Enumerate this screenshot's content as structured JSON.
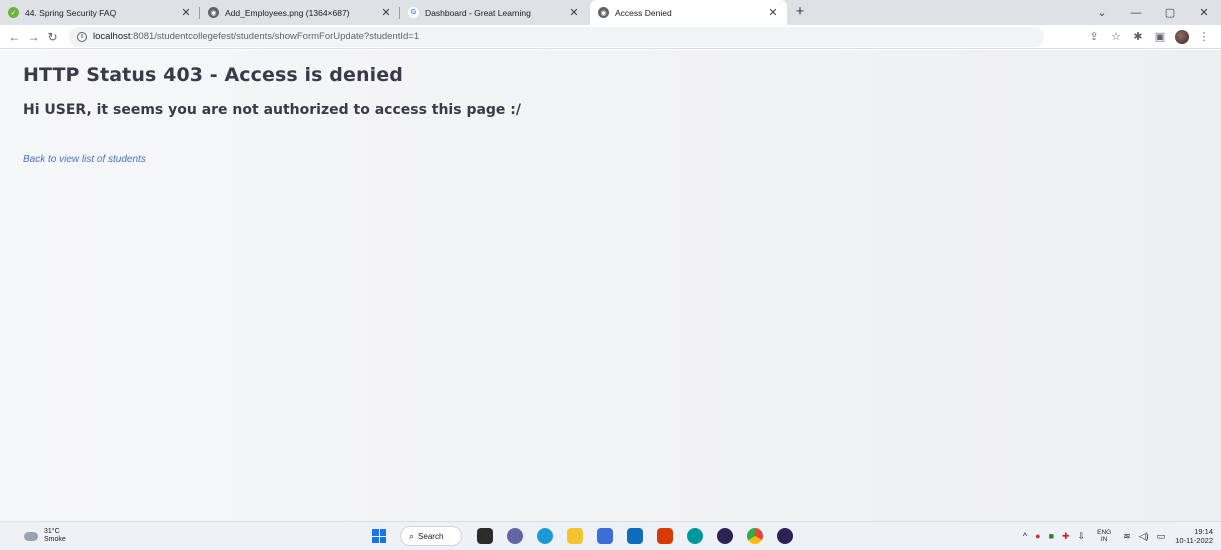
{
  "tabs": [
    {
      "title": "44. Spring Security FAQ",
      "icon": "spring-icon",
      "active": false
    },
    {
      "title": "Add_Employees.png (1364×687)",
      "icon": "globe-icon",
      "active": false
    },
    {
      "title": "Dashboard - Great Learning",
      "icon": "google-icon",
      "active": false
    },
    {
      "title": "Access Denied",
      "icon": "globe-icon",
      "active": true
    }
  ],
  "toolbar": {
    "url_host": "localhost",
    "url_path": ":8081/studentcollegefest/students/showFormForUpdate?studentId=1"
  },
  "page": {
    "heading": "HTTP Status 403 - Access is denied",
    "message": "Hi USER, it seems you are not authorized to access this page :/",
    "back_link": "Back to view list of students"
  },
  "taskbar": {
    "weather_temp": "31°C",
    "weather_desc": "Smoke",
    "search_label": "Search",
    "lang_top": "ENG",
    "lang_bottom": "IN",
    "time": "19:14",
    "date": "10-11-2022"
  },
  "colors": {
    "link": "#4a6fd0",
    "heading": "#3a3a4a",
    "tabstrip": "#dee1e6"
  }
}
